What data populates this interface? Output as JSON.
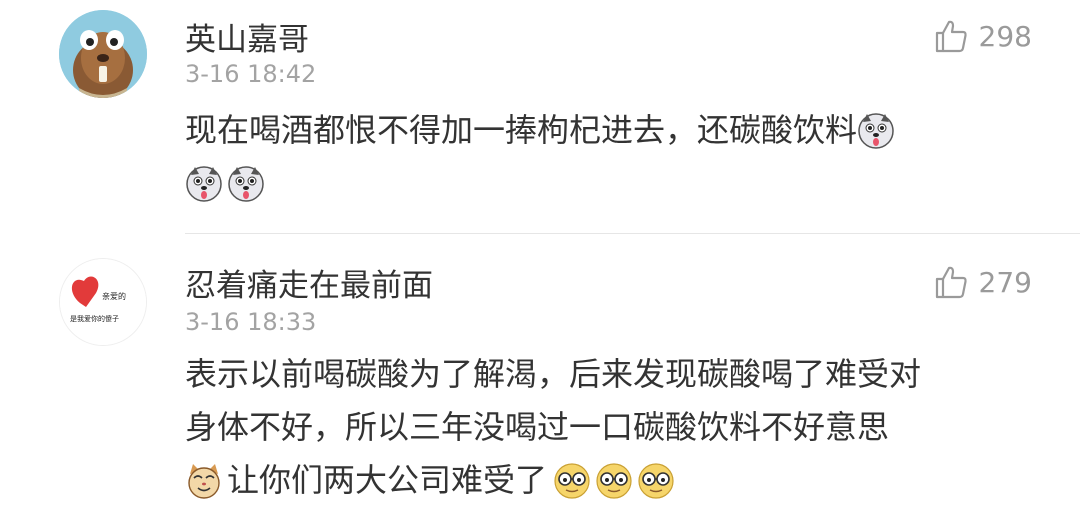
{
  "comments": [
    {
      "username": "英山嘉哥",
      "time": "3-16 18:42",
      "likes": "298",
      "avatar_icon": "squirrel-avatar",
      "lines": [
        "现在喝酒都恨不得加一捧枸杞进去，还碳酸饮料",
        ""
      ],
      "emojis": [
        "husky-emoji",
        "husky-emoji",
        "husky-emoji"
      ]
    },
    {
      "username": "忍着痛走在最前面",
      "time": "3-16 18:33",
      "likes": "279",
      "avatar_icon": "heart-handwriting-avatar",
      "avatar_text": [
        "亲爱的",
        "是我爱你的傻子"
      ],
      "lines": [
        "表示以前喝碳酸为了解渴，后来发现碳酸喝了难受对",
        "身体不好，所以三年没喝过一口碳酸饮料不好意思",
        "让你们两大公司难受了"
      ],
      "emojis": [
        "cat-emoji",
        "doge-glasses-emoji",
        "doge-glasses-emoji",
        "doge-glasses-emoji"
      ]
    }
  ],
  "colors": {
    "text": "#333333",
    "meta": "#a3a3a3",
    "like": "#9a9a9a",
    "divider": "#e6e6e6"
  }
}
